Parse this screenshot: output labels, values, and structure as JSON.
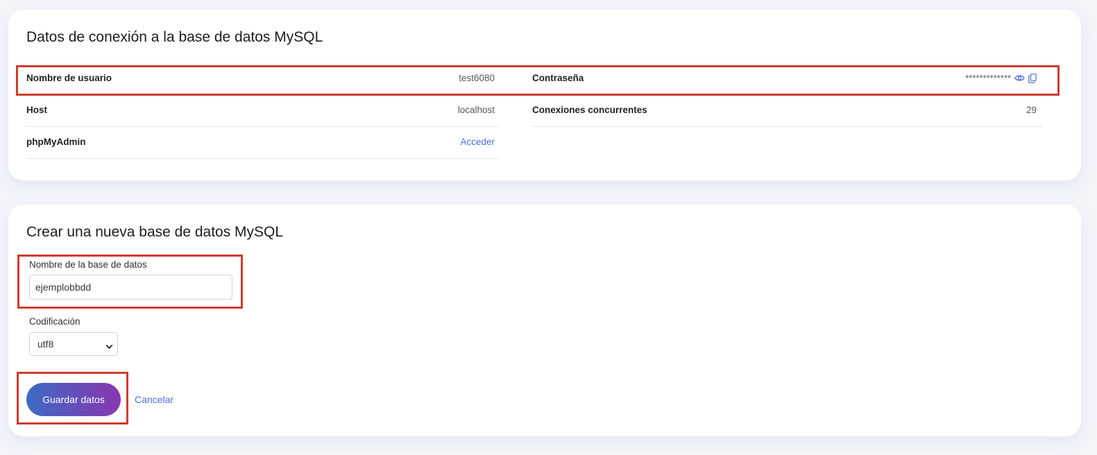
{
  "connection": {
    "title": "Datos de conexión a la base de datos MySQL",
    "username_label": "Nombre de usuario",
    "username_value": "test6080",
    "password_label": "Contraseña",
    "password_value": "*************",
    "host_label": "Host",
    "host_value": "localhost",
    "connections_label": "Conexiones concurrentes",
    "connections_value": "29",
    "phpmyadmin_label": "phpMyAdmin",
    "phpmyadmin_link": "Acceder"
  },
  "create": {
    "title": "Crear una nueva base de datos MySQL",
    "dbname_label": "Nombre de la base de datos",
    "dbname_value": "ejemplobbdd",
    "encoding_label": "Codificación",
    "encoding_selected": "utf8",
    "save_label": "Guardar datos",
    "cancel_label": "Cancelar"
  },
  "colors": {
    "highlight": "#cf3b2e",
    "link": "#4a6fd8",
    "button_gradient_start": "#3c6bc4",
    "button_gradient_end": "#8a36b0"
  },
  "icons": {
    "show_password": "eye-icon",
    "copy_password": "copy-icon",
    "select_arrow": "chevron-down-icon"
  }
}
